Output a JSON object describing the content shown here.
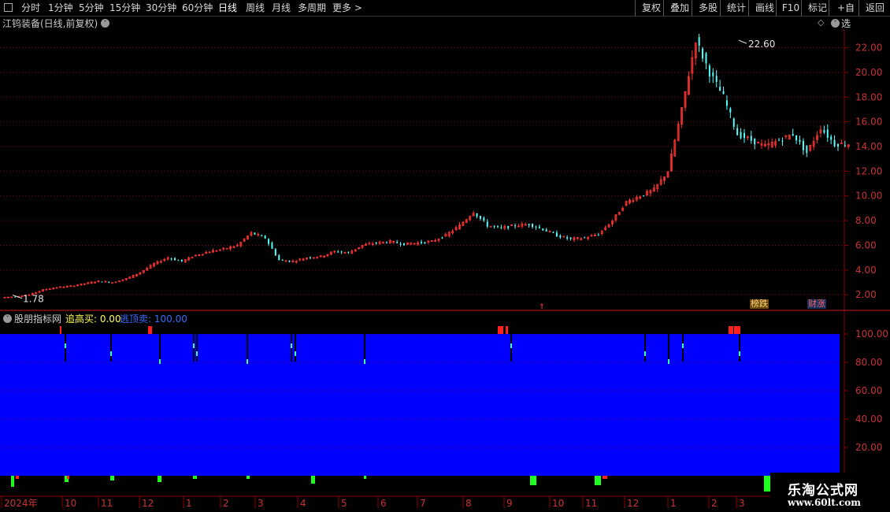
{
  "toolbar": {
    "periods": [
      "分时",
      "1分钟",
      "5分钟",
      "15分钟",
      "30分钟",
      "60分钟",
      "日线",
      "周线",
      "月线",
      "多周期",
      "更多 >"
    ],
    "active_period": "日线",
    "right_buttons": [
      "复权",
      "叠加",
      "多股",
      "统计",
      "画线",
      "F10",
      "标记",
      "+自选",
      "返回"
    ]
  },
  "stock": {
    "title": "江钨装备(日线,前复权)",
    "high_label": "22.60",
    "low_label": "1.78"
  },
  "price_axis": [
    "22.00",
    "20.00",
    "18.00",
    "16.00",
    "14.00",
    "12.00",
    "10.00",
    "8.00",
    "6.00",
    "4.00",
    "2.00"
  ],
  "indicator": {
    "name": "股朋指标网",
    "label1": "追高买: 0.00",
    "label2": "逃顶卖: 100.00",
    "axis": [
      "100.00",
      "80.00",
      "60.00",
      "40.00",
      "20.00"
    ]
  },
  "badges": {
    "left": "榜跌",
    "right": "财涨"
  },
  "date_axis": [
    "2024年",
    "10",
    "11",
    "12",
    "1",
    "2",
    "3",
    "4",
    "5",
    "6",
    "7",
    "8",
    "9",
    "10",
    "11",
    "12",
    "1",
    "2",
    "3"
  ],
  "watermark": {
    "cn": "乐淘公式网",
    "url": "www.60lt.com"
  },
  "colors": {
    "up": "#ff3333",
    "down": "#54ffff",
    "indicator_fill": "#0000ff",
    "grid": "#8b0000",
    "axis_text": "#c83232"
  },
  "chart_data": {
    "type": "candlestick",
    "ylim": [
      0.8,
      23.5
    ],
    "series": [
      {
        "values": [
          1.78,
          1.85,
          2.0,
          2.4,
          2.6,
          2.7,
          2.9,
          3.1,
          3.0,
          3.3,
          3.8,
          4.5,
          5.0,
          4.7,
          5.2,
          5.5,
          5.7,
          6.0,
          7.0,
          6.6,
          4.8,
          4.7,
          5.0,
          5.1,
          5.5,
          5.4,
          6.0,
          6.2,
          6.3,
          6.1,
          6.2,
          6.3,
          6.8,
          7.6,
          8.7,
          7.6,
          7.4,
          7.6,
          7.7,
          7.3,
          6.8,
          6.5,
          6.6,
          6.9,
          8.0,
          9.5,
          10.0,
          10.5,
          12.0,
          17.0,
          22.6,
          20.0,
          18.0,
          15.0,
          14.5,
          14.0,
          14.5,
          15.0,
          13.5,
          15.5,
          14.2
        ]
      }
    ],
    "high": 22.6,
    "low": 1.78
  }
}
